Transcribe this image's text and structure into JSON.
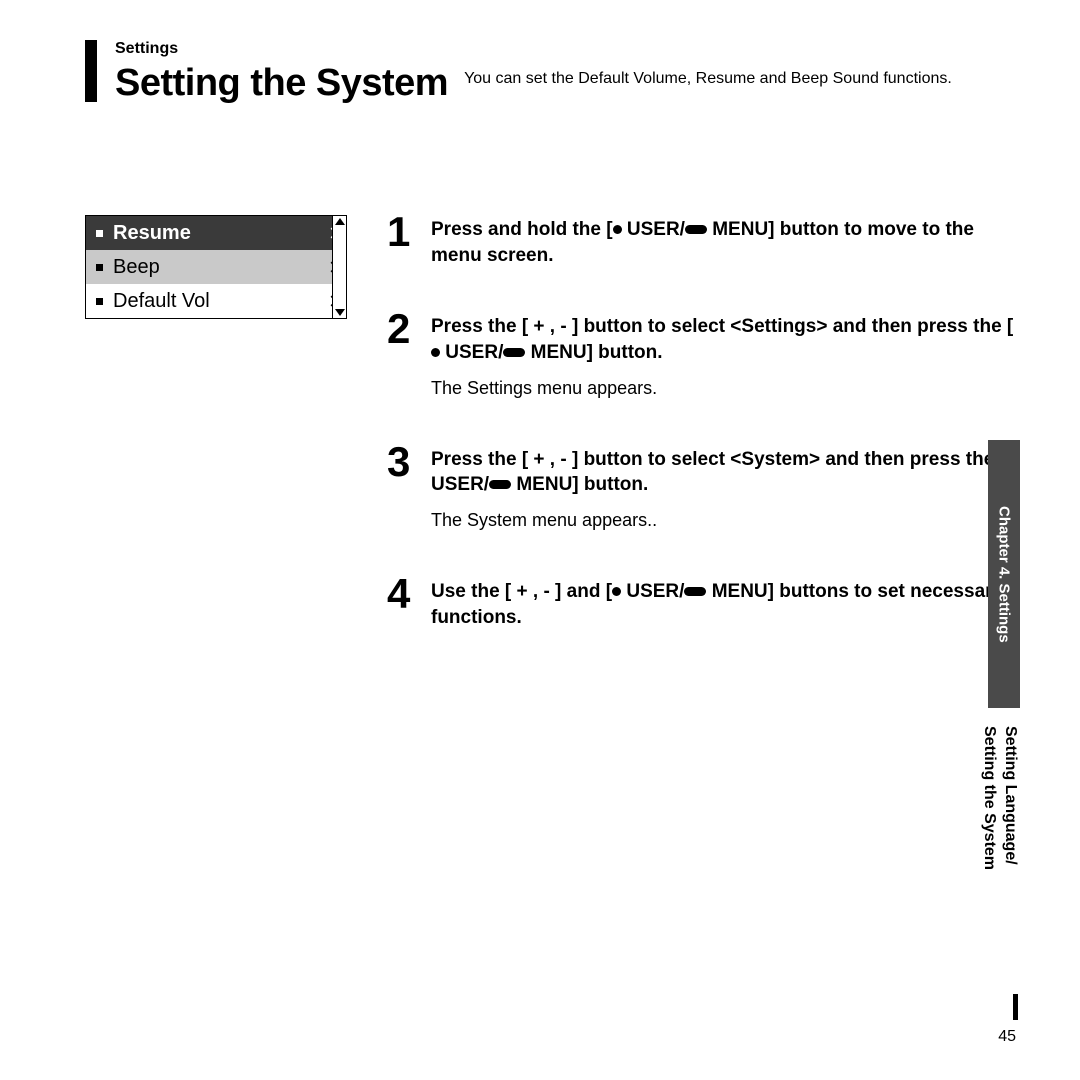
{
  "breadcrumb": "Settings",
  "title": "Setting the System",
  "intro": "You can set the Default Volume, Resume and Beep Sound functions.",
  "menu": {
    "resume": "Resume",
    "beep": "Beep",
    "default_vol": "Default Vol"
  },
  "steps": {
    "s1": {
      "num": "1",
      "a": "Press and hold the [",
      "b": " USER/",
      "c": " MENU] button to move to the menu screen."
    },
    "s2": {
      "num": "2",
      "a": "Press the [ + , - ] button to select <Settings> and then press the [",
      "b": " USER/",
      "c": " MENU] button.",
      "desc": "The Settings menu appears."
    },
    "s3": {
      "num": "3",
      "a": "Press the [ + , - ] button to select <System> and then press the [",
      "b": " USER/",
      "c": " MENU] button.",
      "desc": "The System menu appears.."
    },
    "s4": {
      "num": "4",
      "a": "Use the [ + , - ] and [",
      "b": " USER/",
      "c": " MENU] buttons to set necessary functions."
    }
  },
  "side_dark": "Chapter 4. Settings",
  "side_light_1": "Setting Language/",
  "side_light_2": "Setting the System",
  "page_number": "45"
}
